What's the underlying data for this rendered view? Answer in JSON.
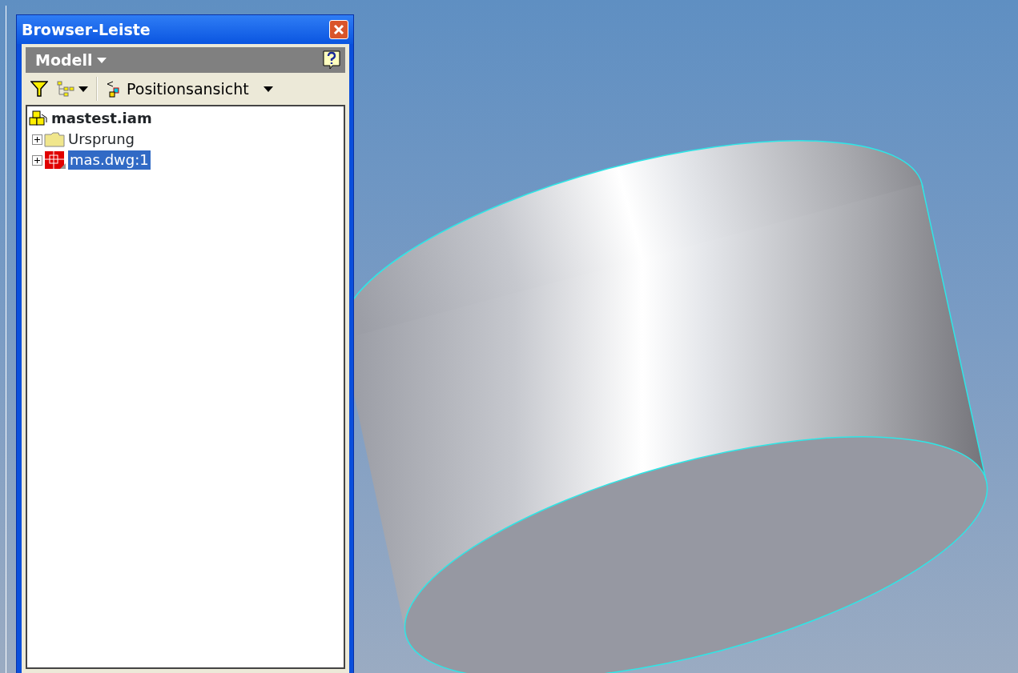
{
  "panel": {
    "title": "Browser-Leiste",
    "dropdown": "Modell",
    "toolbar": {
      "view_dropdown": "Positionsansicht"
    },
    "tree": [
      {
        "label": "mastest.iam",
        "kind": "assembly",
        "selected": false,
        "children": [
          {
            "label": "Ursprung",
            "kind": "folder",
            "expanded": false,
            "selected": false
          },
          {
            "label": "mas.dwg:1",
            "kind": "part",
            "expanded": false,
            "selected": true
          }
        ]
      }
    ]
  }
}
